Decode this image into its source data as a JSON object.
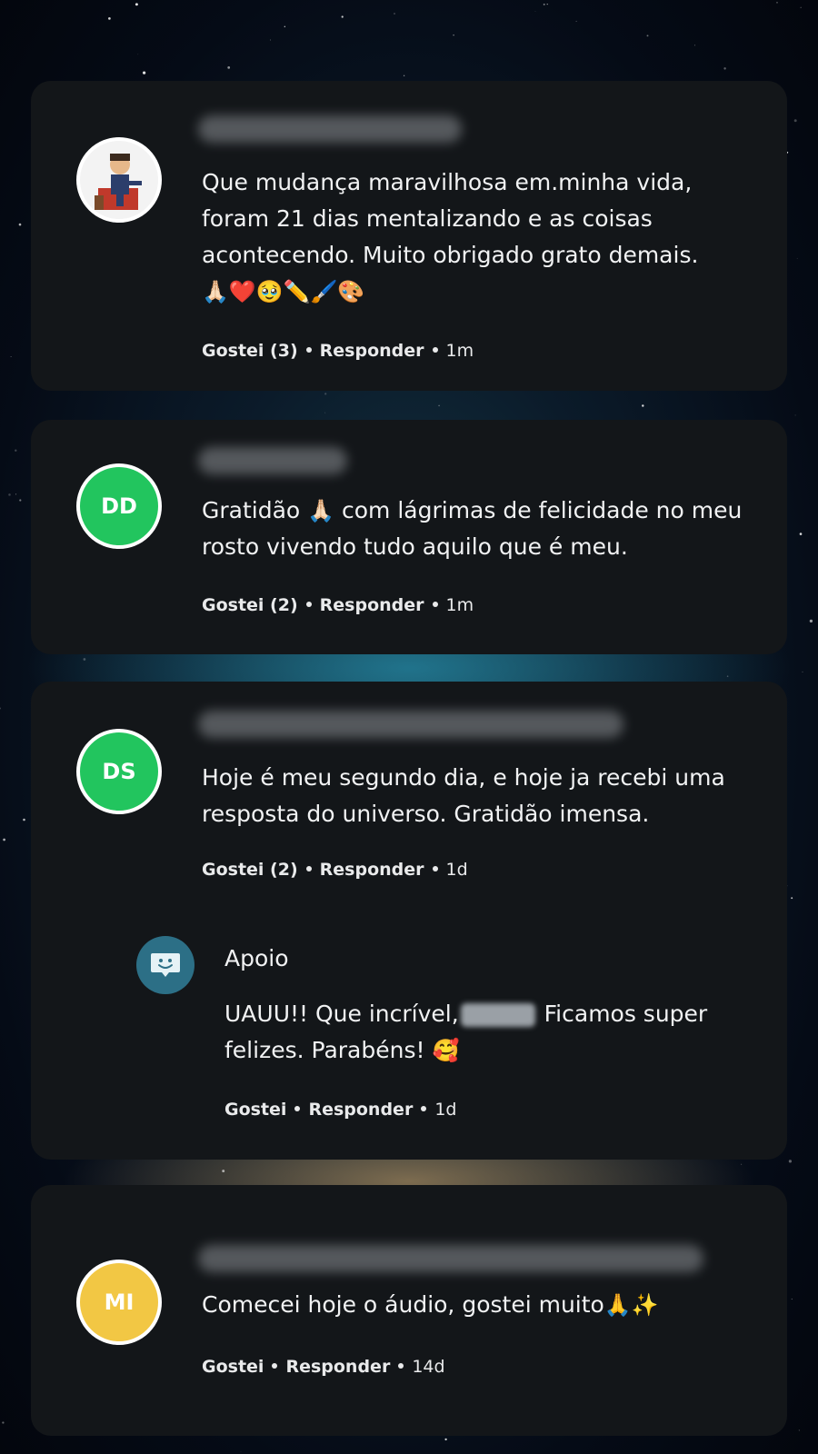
{
  "comments": [
    {
      "avatar_initials": "",
      "text": "Que mudança maravilhosa em.minha vida, foram 21 dias mentalizando e as coisas acontecendo.  Muito obrigado grato demais.",
      "emojis": "🙏🏻❤️🥹✏️🖌️🎨",
      "like_label": "Gostei (3)",
      "reply_label": "Responder",
      "time": "1m"
    },
    {
      "avatar_initials": "DD",
      "avatar_color": "#22c55e",
      "text_before": "Gratidão ",
      "text_emoji": "🙏🏻",
      "text_after": " com lágrimas de felicidade no meu rosto vivendo tudo aquilo que é meu.",
      "like_label": "Gostei (2)",
      "reply_label": "Responder",
      "time": "1m"
    },
    {
      "avatar_initials": "DS",
      "avatar_color": "#22c55e",
      "text": "Hoje é  meu segundo dia, e hoje ja recebi uma resposta do universo. Gratidão imensa.",
      "like_label": "Gostei (2)",
      "reply_label": "Responder",
      "time": "1d",
      "reply": {
        "author": "Apoio",
        "text_before": "UAUU!! Que incrível,",
        "text_after": " Ficamos super felizes. Parabéns! ",
        "emoji": "🥰",
        "like_label": "Gostei",
        "reply_label": "Responder",
        "time": "1d"
      }
    },
    {
      "avatar_initials": "MI",
      "avatar_color": "#f2c744",
      "text": "Comecei hoje o áudio,  gostei muito",
      "emojis": "🙏✨",
      "like_label": "Gostei",
      "reply_label": "Responder",
      "time": "14d"
    }
  ],
  "colors": {
    "card_bg": "#131619",
    "support_avatar": "#2c6f86"
  }
}
